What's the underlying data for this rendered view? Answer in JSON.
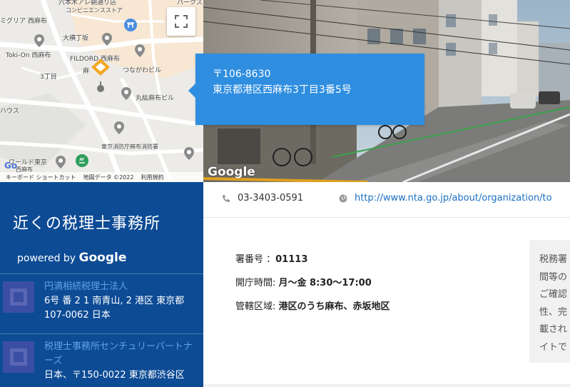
{
  "map": {
    "labels": {
      "top_store": "六本木アレ朝通り店",
      "top_store2": "コンビニエンスストア",
      "miglia": "ミグリア 西麻布",
      "okubo": "大横丁坂",
      "tokion": "Toki-On 西麻布",
      "fildoro": "FILDORD 西麻布",
      "azabu": "麻",
      "tsunagawa": "つながわビル",
      "chome3": "3丁目",
      "maruko": "丸紘麻布ビル",
      "house": "ハウス",
      "fire": "東京消防庁麻布消防署",
      "world": "ワールド東京",
      "world2": "西麻布",
      "pax": "パークス"
    },
    "footer": {
      "keyboard": "キーボード ショートカット",
      "mapdata": "地図データ ©2022",
      "terms": "利用規約"
    },
    "logo": "Go"
  },
  "street": {
    "logo": "Google"
  },
  "bubble": {
    "postal": "〒106-8630",
    "address": "東京都港区西麻布3丁目3番5号"
  },
  "panel": {
    "title": "近くの税理士事務所",
    "powered_by": "powered by",
    "google": "Google",
    "offices": [
      {
        "name": "円満相続税理士法人",
        "address": "6号 番 2 1 南青山, 2 港区 東京都 107-0062 日本"
      },
      {
        "name": "税理士事務所センチュリーパートナーズ",
        "address": "日本、〒150-0022 東京都渋谷区"
      }
    ]
  },
  "contact": {
    "phone": "03-3403-0591",
    "website": "http://www.nta.go.jp/about/organization/to"
  },
  "info": {
    "office_no_label": "署番号 ：",
    "office_no": "01113",
    "hours_label": "開庁時間: ",
    "hours": "月～金 8:30～17:00",
    "area_label": "管轄区域: ",
    "area": "港区のうち麻布、赤坂地区"
  },
  "note": {
    "lines": [
      "税務署",
      "間等の",
      "ご確認",
      "性、完",
      "載され",
      "イトで"
    ]
  },
  "colors": {
    "panel_bg": "#0d4b95",
    "bubble_bg": "#2f8ee0",
    "link": "#1a6fc1",
    "office_name": "#5ea3ec"
  }
}
